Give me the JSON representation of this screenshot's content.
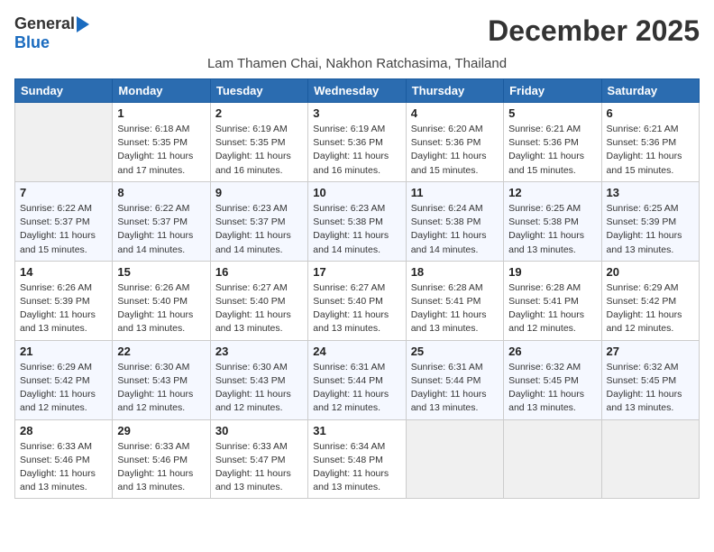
{
  "logo": {
    "general": "General",
    "blue": "Blue"
  },
  "title": "December 2025",
  "subtitle": "Lam Thamen Chai, Nakhon Ratchasima, Thailand",
  "headers": [
    "Sunday",
    "Monday",
    "Tuesday",
    "Wednesday",
    "Thursday",
    "Friday",
    "Saturday"
  ],
  "weeks": [
    [
      {
        "day": "",
        "info": ""
      },
      {
        "day": "1",
        "info": "Sunrise: 6:18 AM\nSunset: 5:35 PM\nDaylight: 11 hours\nand 17 minutes."
      },
      {
        "day": "2",
        "info": "Sunrise: 6:19 AM\nSunset: 5:35 PM\nDaylight: 11 hours\nand 16 minutes."
      },
      {
        "day": "3",
        "info": "Sunrise: 6:19 AM\nSunset: 5:36 PM\nDaylight: 11 hours\nand 16 minutes."
      },
      {
        "day": "4",
        "info": "Sunrise: 6:20 AM\nSunset: 5:36 PM\nDaylight: 11 hours\nand 15 minutes."
      },
      {
        "day": "5",
        "info": "Sunrise: 6:21 AM\nSunset: 5:36 PM\nDaylight: 11 hours\nand 15 minutes."
      },
      {
        "day": "6",
        "info": "Sunrise: 6:21 AM\nSunset: 5:36 PM\nDaylight: 11 hours\nand 15 minutes."
      }
    ],
    [
      {
        "day": "7",
        "info": "Sunrise: 6:22 AM\nSunset: 5:37 PM\nDaylight: 11 hours\nand 15 minutes."
      },
      {
        "day": "8",
        "info": "Sunrise: 6:22 AM\nSunset: 5:37 PM\nDaylight: 11 hours\nand 14 minutes."
      },
      {
        "day": "9",
        "info": "Sunrise: 6:23 AM\nSunset: 5:37 PM\nDaylight: 11 hours\nand 14 minutes."
      },
      {
        "day": "10",
        "info": "Sunrise: 6:23 AM\nSunset: 5:38 PM\nDaylight: 11 hours\nand 14 minutes."
      },
      {
        "day": "11",
        "info": "Sunrise: 6:24 AM\nSunset: 5:38 PM\nDaylight: 11 hours\nand 14 minutes."
      },
      {
        "day": "12",
        "info": "Sunrise: 6:25 AM\nSunset: 5:38 PM\nDaylight: 11 hours\nand 13 minutes."
      },
      {
        "day": "13",
        "info": "Sunrise: 6:25 AM\nSunset: 5:39 PM\nDaylight: 11 hours\nand 13 minutes."
      }
    ],
    [
      {
        "day": "14",
        "info": "Sunrise: 6:26 AM\nSunset: 5:39 PM\nDaylight: 11 hours\nand 13 minutes."
      },
      {
        "day": "15",
        "info": "Sunrise: 6:26 AM\nSunset: 5:40 PM\nDaylight: 11 hours\nand 13 minutes."
      },
      {
        "day": "16",
        "info": "Sunrise: 6:27 AM\nSunset: 5:40 PM\nDaylight: 11 hours\nand 13 minutes."
      },
      {
        "day": "17",
        "info": "Sunrise: 6:27 AM\nSunset: 5:40 PM\nDaylight: 11 hours\nand 13 minutes."
      },
      {
        "day": "18",
        "info": "Sunrise: 6:28 AM\nSunset: 5:41 PM\nDaylight: 11 hours\nand 13 minutes."
      },
      {
        "day": "19",
        "info": "Sunrise: 6:28 AM\nSunset: 5:41 PM\nDaylight: 11 hours\nand 12 minutes."
      },
      {
        "day": "20",
        "info": "Sunrise: 6:29 AM\nSunset: 5:42 PM\nDaylight: 11 hours\nand 12 minutes."
      }
    ],
    [
      {
        "day": "21",
        "info": "Sunrise: 6:29 AM\nSunset: 5:42 PM\nDaylight: 11 hours\nand 12 minutes."
      },
      {
        "day": "22",
        "info": "Sunrise: 6:30 AM\nSunset: 5:43 PM\nDaylight: 11 hours\nand 12 minutes."
      },
      {
        "day": "23",
        "info": "Sunrise: 6:30 AM\nSunset: 5:43 PM\nDaylight: 11 hours\nand 12 minutes."
      },
      {
        "day": "24",
        "info": "Sunrise: 6:31 AM\nSunset: 5:44 PM\nDaylight: 11 hours\nand 12 minutes."
      },
      {
        "day": "25",
        "info": "Sunrise: 6:31 AM\nSunset: 5:44 PM\nDaylight: 11 hours\nand 13 minutes."
      },
      {
        "day": "26",
        "info": "Sunrise: 6:32 AM\nSunset: 5:45 PM\nDaylight: 11 hours\nand 13 minutes."
      },
      {
        "day": "27",
        "info": "Sunrise: 6:32 AM\nSunset: 5:45 PM\nDaylight: 11 hours\nand 13 minutes."
      }
    ],
    [
      {
        "day": "28",
        "info": "Sunrise: 6:33 AM\nSunset: 5:46 PM\nDaylight: 11 hours\nand 13 minutes."
      },
      {
        "day": "29",
        "info": "Sunrise: 6:33 AM\nSunset: 5:46 PM\nDaylight: 11 hours\nand 13 minutes."
      },
      {
        "day": "30",
        "info": "Sunrise: 6:33 AM\nSunset: 5:47 PM\nDaylight: 11 hours\nand 13 minutes."
      },
      {
        "day": "31",
        "info": "Sunrise: 6:34 AM\nSunset: 5:48 PM\nDaylight: 11 hours\nand 13 minutes."
      },
      {
        "day": "",
        "info": ""
      },
      {
        "day": "",
        "info": ""
      },
      {
        "day": "",
        "info": ""
      }
    ]
  ]
}
